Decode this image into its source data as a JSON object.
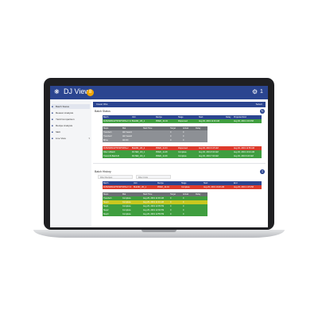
{
  "app": {
    "title": "DJ View",
    "badge": "8",
    "user_count": "1",
    "logo_icon": "home-icon",
    "accent": "#2b4590"
  },
  "sidebar": {
    "items": [
      {
        "label": "Batch Status",
        "active": true
      },
      {
        "label": "Reason Analysis"
      },
      {
        "label": "Yield Comparison"
      },
      {
        "label": "Recipe Analysis"
      },
      {
        "label": "SEC"
      },
      {
        "label": "Live View"
      }
    ]
  },
  "header": {
    "left": "Invest Obs",
    "right": "Select"
  },
  "batch_status": {
    "title": "Batch Status",
    "columns": [
      "Batch",
      "Unit",
      "Recipe",
      "Stage",
      "Start",
      "Delay",
      "Projected End"
    ],
    "row1": [
      "R-PENDINGPHOSPHATE-1Y-0",
      "BLEND_UN_1",
      "PRED_10-04",
      "Dispensed",
      "Aug 30, 2019 11:40 AM",
      "",
      "Aug 30, 2019 1:00 PM"
    ],
    "sub_columns": [
      "Steps",
      "Mat",
      "Start Time",
      "Target",
      "Actual",
      "Delay"
    ],
    "sub_rows": [
      [
        "Transfer1",
        "AR-Yeast1",
        "",
        "0",
        "0",
        ""
      ],
      [
        "Transfer2",
        "AR-Yeast2",
        "",
        "0",
        "0",
        ""
      ],
      [
        "Brine",
        "AR-Oil",
        "",
        "0",
        "0",
        ""
      ]
    ],
    "row2": [
      "R-PENDINGPHOSPHATE-2",
      "BLEND_UN_2",
      "PRED_11-04",
      "Dispensed",
      "Aug 30, 2019 9:15 AM",
      "",
      "Aug 30, 2019 11:58 AM"
    ],
    "row3": [
      "Filter 4-Batch",
      "FILTER_UN_1",
      "PRED_11-08",
      "Complete",
      "Aug 30, 2019 8:40 AM",
      "",
      "Aug 30, 2019 10:10 AM"
    ],
    "row4": [
      "Transit R-Batch-B",
      "FILTER_UN_2",
      "PRED_11-09",
      "Complete",
      "Aug 30, 2019 7:20 AM",
      "",
      "Aug 30, 2019 9:40 AM"
    ]
  },
  "batch_history": {
    "title": "Batch History",
    "filter_placeholder": "Filter Recipes",
    "filter2_placeholder": "Filter Units",
    "columns": [
      "Batch",
      "Unit",
      "Recipe",
      "Stage",
      "Start",
      "End"
    ],
    "row1": [
      "R-PENDINGPHOSPHATE-1Y-0",
      "BLEND_UN_1",
      "PRED_10-04",
      "Complete",
      "Aug 29, 2019 10:20 AM",
      "Aug 29, 2019 1:15 PM"
    ],
    "sub_columns": [
      "Steps",
      "Mat",
      "Start Time",
      "Target",
      "Actual",
      "Delay"
    ],
    "sub_rows": [
      [
        "Transfer1",
        "Complete",
        "Aug 29, 2019 11:00 AM",
        "0",
        "0",
        ""
      ],
      [
        "Step4",
        "Complete",
        "Aug 29, 2019 11:40 AM",
        "0",
        "0",
        ""
      ],
      [
        "Step1",
        "Complete",
        "Aug 29, 2019 12:05 PM",
        "0",
        "0",
        ""
      ],
      [
        "Step2",
        "Complete",
        "Aug 29, 2019 12:30 PM",
        "0",
        "0",
        ""
      ],
      [
        "Step3",
        "Complete",
        "Aug 29, 2019 12:55 PM",
        "0",
        "0",
        ""
      ]
    ]
  }
}
